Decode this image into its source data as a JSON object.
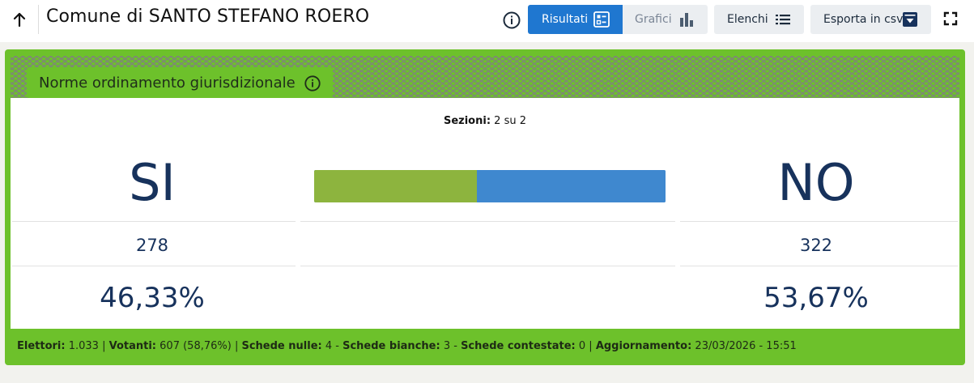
{
  "header": {
    "title": "Comune di SANTO STEFANO ROERO",
    "buttons": {
      "risultati": "Risultati",
      "grafici": "Grafici",
      "elenchi": "Elenchi",
      "csv": "Esporta in csv"
    },
    "icons": [
      "arrow-up-icon",
      "info-icon",
      "list-card-icon",
      "bar-chart-icon",
      "list-icon",
      "download-icon",
      "fullscreen-icon"
    ]
  },
  "referendum": {
    "tag": "Norme ordinamento giurisdizionale",
    "sezioni_label": "Sezioni:",
    "sezioni_value": "2 su 2",
    "si": {
      "label": "SI",
      "votes": "278",
      "percent": "46,33%",
      "share": 0.4633,
      "color": "#8db43e"
    },
    "no": {
      "label": "NO",
      "votes": "322",
      "percent": "53,67%",
      "share": 0.5367,
      "color": "#3f88cf"
    }
  },
  "footer": {
    "elettori_label": "Elettori:",
    "elettori_value": "1.033",
    "votanti_label": "Votanti:",
    "votanti_value": "607 (58,76%)",
    "nulle_label": "Schede nulle:",
    "nulle_value": "4",
    "bianche_label": "Schede bianche:",
    "bianche_value": "3",
    "contestate_label": "Schede contestate:",
    "contestate_value": "0",
    "aggiornamento_label": "Aggiornamento:",
    "aggiornamento_value": "23/03/2026 - 15:51"
  },
  "colors": {
    "accent": "#1f77d0",
    "card": "#6dc12b",
    "navy": "#17325c"
  }
}
